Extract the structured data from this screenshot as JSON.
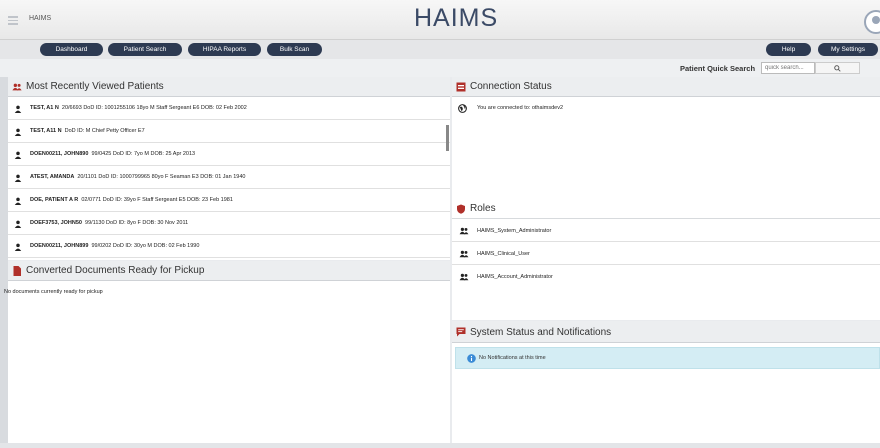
{
  "header": {
    "app_name": "HAIMS",
    "logo": "HAIMS"
  },
  "nav": {
    "left": [
      "Dashboard",
      "Patient Search",
      "HIPAA Reports",
      "Bulk Scan"
    ],
    "right": [
      "Help",
      "My Settings"
    ]
  },
  "quick_search": {
    "label": "Patient Quick Search",
    "placeholder": "quick search...",
    "button_icon": "search-icon"
  },
  "recent": {
    "title": "Most Recently Viewed Patients",
    "rows": [
      {
        "name": "TEST, A1 N",
        "details": "20/6693  DoD ID: 1001255106  18yo  M  Staff Sergeant E6  DOB: 02 Feb 2002"
      },
      {
        "name": "TEST, A11 N",
        "details": "DoD ID:  M  Chief Petty Officer E7"
      },
      {
        "name": "DOEN00211, JOHN890",
        "details": "99/0425  DoD ID:  7yo  M  DOB: 25 Apr 2013"
      },
      {
        "name": "ATEST, AMANDA",
        "details": "20/1101  DoD ID: 1000799965  80yo  F  Seaman E3  DOB: 01 Jan 1940"
      },
      {
        "name": "DOE, PATIENT A R",
        "details": "02/0771  DoD ID:  39yo  F  Staff Sergeant E5  DOB: 23 Feb 1981"
      },
      {
        "name": "DOEF3753, JOHN50",
        "details": "99/1130  DoD ID:  8yo  F  DOB: 30 Nov 2011"
      },
      {
        "name": "DOEN00211, JOHN899",
        "details": "99/0202  DoD ID:  30yo  M  DOB: 02 Feb 1990"
      }
    ]
  },
  "converted": {
    "title": "Converted Documents Ready for Pickup",
    "empty": "No documents currently ready for pickup"
  },
  "connection": {
    "title": "Connection Status",
    "text": "You are connected to: othaimsdev2"
  },
  "roles": {
    "title": "Roles",
    "items": [
      "HAIMS_System_Administrator",
      "HAIMS_Clinical_User",
      "HAIMS_Account_Administrator"
    ]
  },
  "notifications": {
    "title": "System Status and Notifications",
    "text": "No Notifications at this time"
  },
  "colors": {
    "nav_button": "#2d3a52",
    "accent_red": "#b0302a",
    "info_bg": "#d4edf4",
    "info_icon": "#3a8bd6"
  }
}
